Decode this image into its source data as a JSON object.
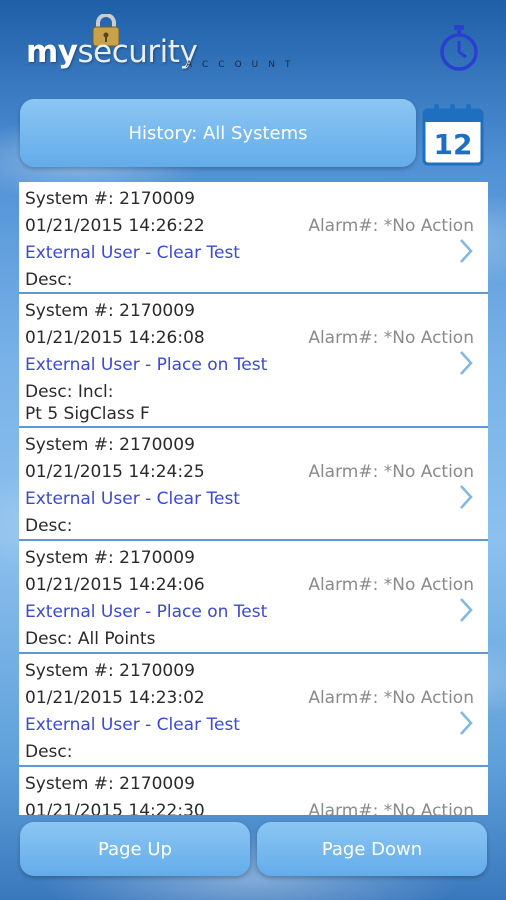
{
  "header": {
    "logo_my": "my",
    "logo_security": "security",
    "logo_sub": "ACCOUNT"
  },
  "title_bar": {
    "label": "History: All Systems"
  },
  "calendar": {
    "day": "12"
  },
  "entries": [
    {
      "system": "System #: 2170009",
      "datetime": "01/21/2015 14:26:22",
      "alarm": "Alarm#: *No Action",
      "action": "External User - Clear Test",
      "desc": "Desc:",
      "desc2": ""
    },
    {
      "system": "System #: 2170009",
      "datetime": "01/21/2015 14:26:08",
      "alarm": "Alarm#: *No Action",
      "action": "External User - Place on Test",
      "desc": "Desc:   Incl:",
      "desc2": "Pt 5 SigClass F"
    },
    {
      "system": "System #: 2170009",
      "datetime": "01/21/2015 14:24:25",
      "alarm": "Alarm#: *No Action",
      "action": "External User - Clear Test",
      "desc": "Desc:",
      "desc2": ""
    },
    {
      "system": "System #: 2170009",
      "datetime": "01/21/2015 14:24:06",
      "alarm": "Alarm#: *No Action",
      "action": "External User - Place on Test",
      "desc": "Desc:   All Points",
      "desc2": ""
    },
    {
      "system": "System #: 2170009",
      "datetime": "01/21/2015 14:23:02",
      "alarm": "Alarm#: *No Action",
      "action": "External User - Clear Test",
      "desc": "Desc:",
      "desc2": ""
    },
    {
      "system": "System #: 2170009",
      "datetime": "01/21/2015 14:22:30",
      "alarm": "Alarm#: *No Action",
      "action": "",
      "desc": "",
      "desc2": ""
    }
  ],
  "buttons": {
    "page_up": "Page Up",
    "page_down": "Page Down"
  },
  "colors": {
    "accent": "#63acea",
    "action_text": "#3a49d6",
    "alarm_text": "#8a8a8a"
  }
}
